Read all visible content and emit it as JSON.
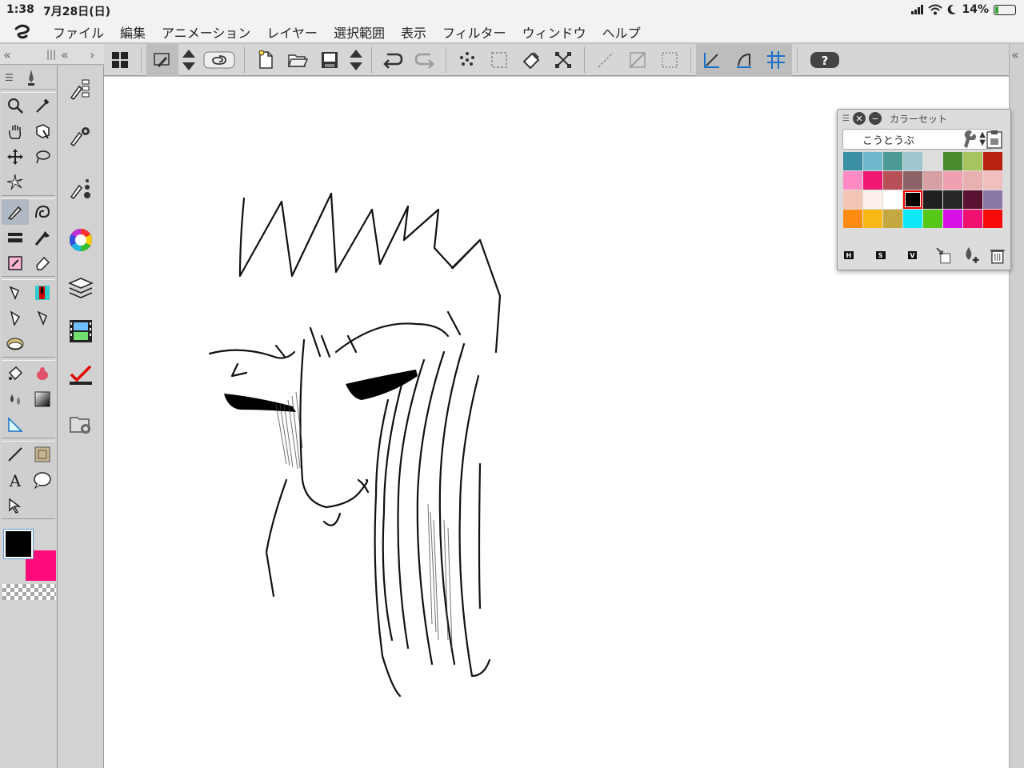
{
  "status": {
    "time": "1:38",
    "date": "7月28日(日)",
    "battery": "14%",
    "battery_level": 0.14
  },
  "menu": [
    "ファイル",
    "編集",
    "アニメーション",
    "レイヤー",
    "選択範囲",
    "表示",
    "フィルター",
    "ウィンドウ",
    "ヘルプ"
  ],
  "colorset": {
    "title": "カラーセット",
    "selected_set": "こうとうぶ",
    "hsv": [
      "H",
      "S",
      "V"
    ],
    "swatches": [
      "#3a8fa2",
      "#6fb8cc",
      "#4c9a96",
      "#9ec6cf",
      "#dedede",
      "#4c8a30",
      "#a8c45e",
      "#b82010",
      "#ff8ac4",
      "#f01870",
      "#b85058",
      "#8c6468",
      "#d6a0a4",
      "#f0a0b0",
      "#e8b0b0",
      "#f0c0c0",
      "#f4c4b4",
      "#fcf0ea",
      "#ffffff",
      "#000000",
      "#202020",
      "#262626",
      "#5a1030",
      "#8a78a8",
      "#ff8c10",
      "#f8b818",
      "#c4a840",
      "#10e8f8",
      "#58c818",
      "#d810e8",
      "#f01070",
      "#f80a0a"
    ],
    "selected_index": 19
  },
  "main_color": "#000000",
  "sub_color": "#ff0a7a"
}
